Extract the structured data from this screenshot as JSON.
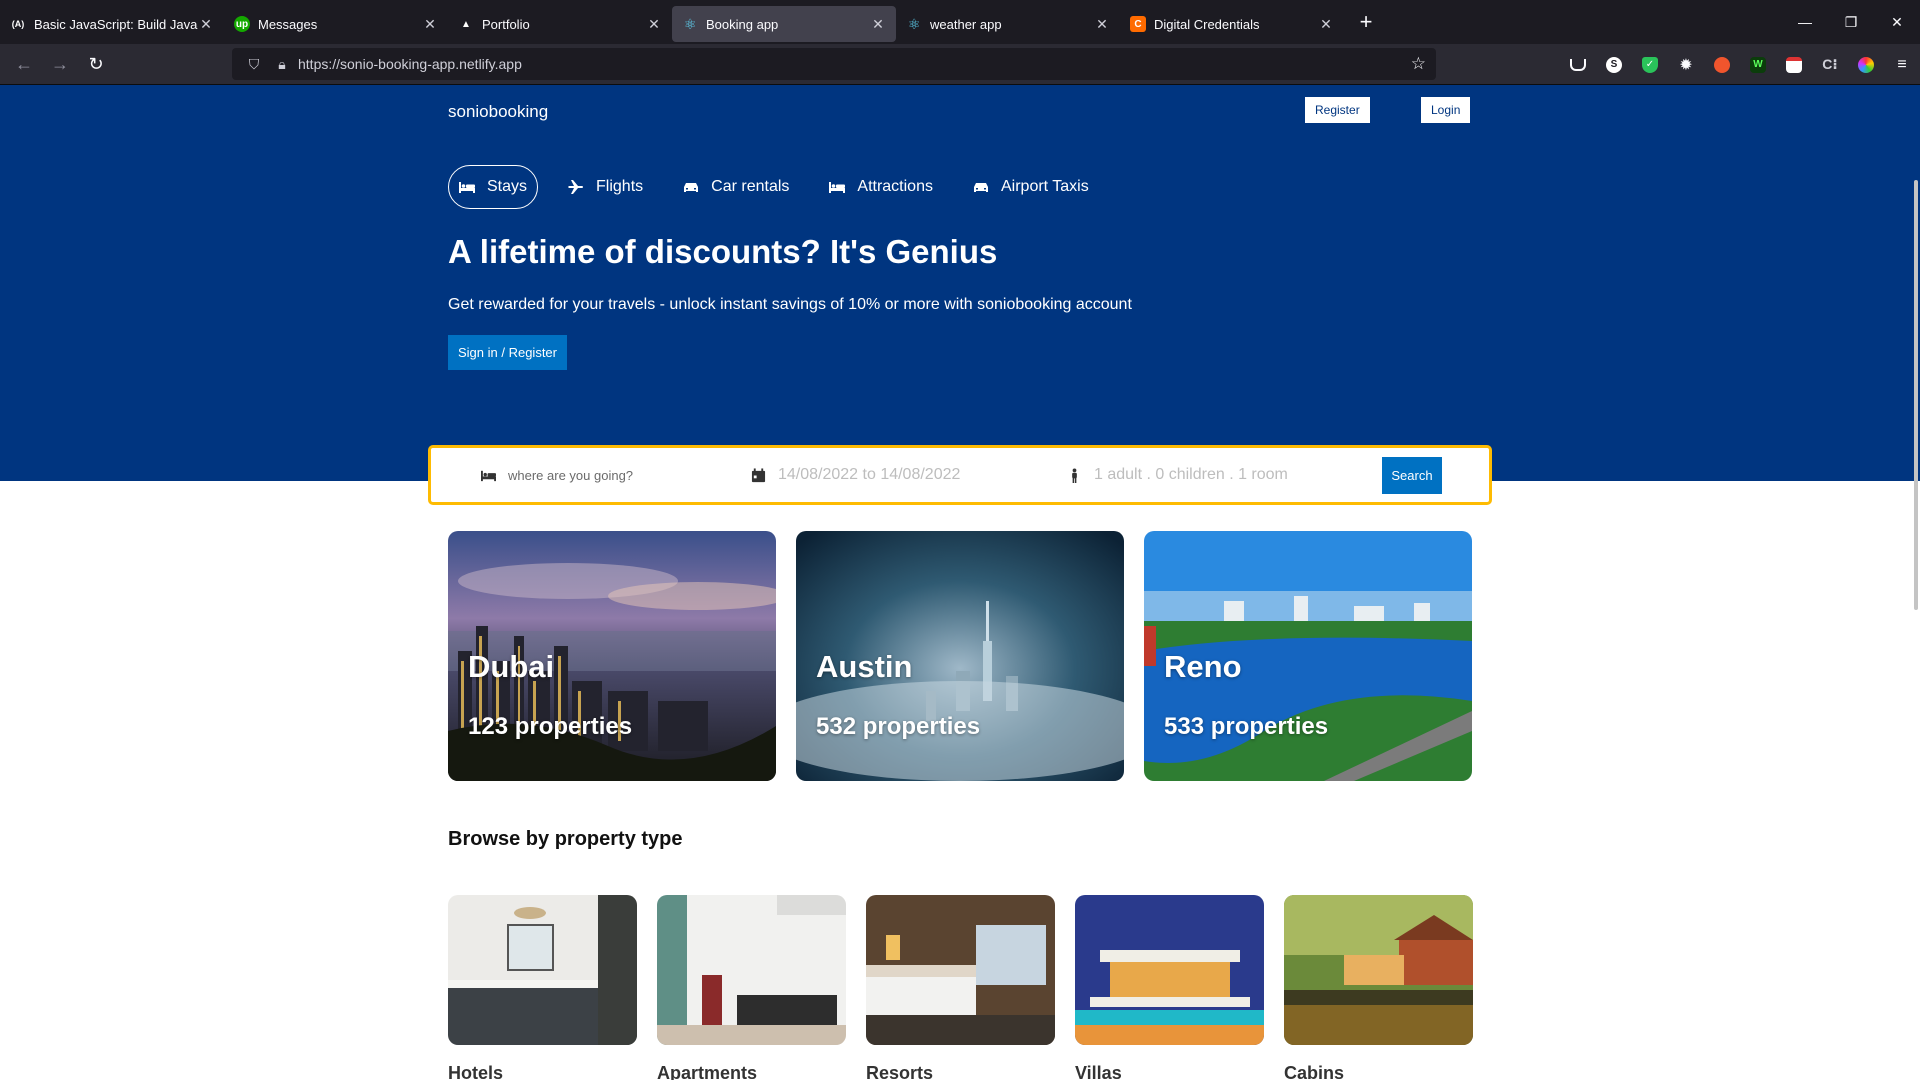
{
  "browser": {
    "tabs": [
      {
        "title": "Basic JavaScript: Build JavaScrip",
        "favicon": "freecodecamp-icon",
        "fav_text": "(A)",
        "fav_color": "#ffffff",
        "active": false
      },
      {
        "title": "Messages",
        "favicon": "upwork-icon",
        "fav_text": "up",
        "fav_color": "#14a800",
        "active": false
      },
      {
        "title": "Portfolio",
        "favicon": "vercel-icon",
        "fav_text": "▲",
        "fav_color": "#ffffff",
        "active": false
      },
      {
        "title": "Booking app",
        "favicon": "react-icon",
        "fav_text": "⚛",
        "fav_color": "#61dafb",
        "active": true
      },
      {
        "title": "weather app",
        "favicon": "react-icon",
        "fav_text": "⚛",
        "fav_color": "#61dafb",
        "active": false
      },
      {
        "title": "Digital Credentials",
        "favicon": "credly-icon",
        "fav_text": "C",
        "fav_color": "#ff6b00",
        "active": false
      }
    ],
    "url": "https://sonio-booking-app.netlify.app"
  },
  "header": {
    "brand": "soniobooking",
    "register": "Register",
    "login": "Login"
  },
  "nav": [
    {
      "label": "Stays",
      "icon": "bed-icon",
      "active": true
    },
    {
      "label": "Flights",
      "icon": "plane-icon",
      "active": false
    },
    {
      "label": "Car rentals",
      "icon": "car-icon",
      "active": false
    },
    {
      "label": "Attractions",
      "icon": "bed-icon",
      "active": false
    },
    {
      "label": "Airport Taxis",
      "icon": "taxi-icon",
      "active": false
    }
  ],
  "hero": {
    "title": "A lifetime of discounts? It's Genius",
    "desc": "Get rewarded for your travels - unlock instant savings of 10% or more with soniobooking account",
    "cta": "Sign in / Register"
  },
  "search": {
    "destination_placeholder": "where are you going?",
    "dates": "14/08/2022 to 14/08/2022",
    "guests": "1 adult . 0 children . 1 room",
    "button": "Search"
  },
  "featured": [
    {
      "city": "Dubai",
      "properties": "123 properties"
    },
    {
      "city": "Austin",
      "properties": "532 properties"
    },
    {
      "city": "Reno",
      "properties": "533 properties"
    }
  ],
  "property_types": {
    "title": "Browse by property type",
    "items": [
      "Hotels",
      "Apartments",
      "Resorts",
      "Villas",
      "Cabins"
    ]
  },
  "colors": {
    "brand": "#003580",
    "accent": "#0071c2",
    "search_border": "#febb02"
  }
}
